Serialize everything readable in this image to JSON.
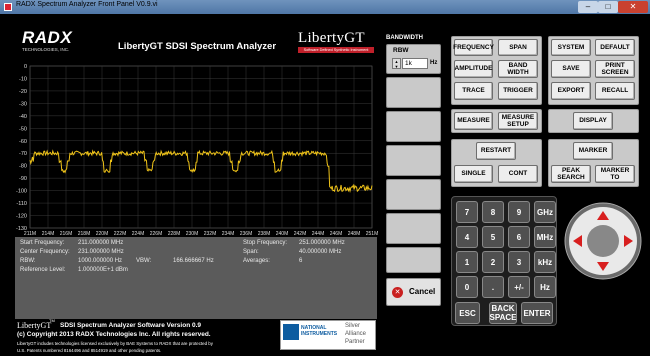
{
  "window": {
    "title": "RADX Spectrum Analyzer Front Panel V0.9.vi",
    "min": "–",
    "max": "□",
    "close": "✕"
  },
  "brand": {
    "radx_logo": "RADX",
    "radx_sub": "TECHNOLOGIES, INC.",
    "product_logo": "LibertyGT",
    "product_tagline": "Software Defined Synthetic Instrument",
    "footer_logo": "LibertyGT",
    "footer_tm": "TM"
  },
  "chart_data": {
    "type": "line",
    "title": "LibertyGT SDSI Spectrum Analyzer",
    "xlabel": "",
    "ylabel": "",
    "x_ticks": [
      "211M",
      "214M",
      "216M",
      "218M",
      "220M",
      "222M",
      "224M",
      "226M",
      "228M",
      "230M",
      "232M",
      "234M",
      "236M",
      "238M",
      "240M",
      "242M",
      "244M",
      "246M",
      "248M",
      "251M"
    ],
    "y_ticks": [
      "0",
      "-10",
      "-20",
      "-30",
      "-40",
      "-50",
      "-60",
      "-70",
      "-80",
      "-90",
      "-100",
      "-110",
      "-120",
      "-130"
    ],
    "xlim": [
      211,
      251
    ],
    "ylim": [
      -130,
      0
    ],
    "grid": true,
    "trace_color": "#f0c419",
    "series": [
      {
        "values": [
          -70,
          -70,
          -70,
          -70,
          -70,
          -70,
          -70,
          -70,
          -70,
          -70,
          -70,
          -70,
          -70,
          -70,
          -70,
          -70,
          -70,
          -70,
          -70,
          -70,
          -70,
          -70,
          -70,
          -70,
          -70,
          -70,
          -70,
          -70,
          -70,
          -70,
          -70,
          -70,
          -70,
          -70,
          -70,
          -70,
          -70,
          -70,
          -70,
          -70,
          -70,
          -70,
          -70,
          -70,
          -70,
          -70,
          -70,
          -70,
          -70,
          -70,
          -70,
          -70,
          -70,
          -70,
          -70,
          -70,
          -70,
          -70,
          -70,
          -70,
          -70,
          -70,
          -70,
          -70,
          -70,
          -70,
          -70,
          -70,
          -70,
          -70,
          -70,
          -70,
          -70,
          -70,
          -70,
          -70,
          -70,
          -70,
          -70,
          -70
        ],
        "x_start": 211,
        "x_end": 251
      }
    ],
    "nulls_at": [
      215,
      220,
      225,
      230,
      235,
      240
    ],
    "null_depth": -84,
    "signal_level": -70,
    "noise_floor": -98,
    "step_at": 246
  },
  "bandwidth": {
    "label": "BANDWIDTH",
    "rbw_label": "RBW",
    "rbw_value": "1k",
    "rbw_unit": "Hz"
  },
  "keys": {
    "frequency": "FREQUENCY",
    "span": "SPAN",
    "amplitude": "AMPLITUDE",
    "bandwidth": "BAND WIDTH",
    "trace": "TRACE",
    "trigger": "TRIGGER",
    "system": "SYSTEM",
    "default": "DEFAULT",
    "save": "SAVE",
    "print": "PRINT SCREEN",
    "export": "EXPORT",
    "recall": "RECALL",
    "measure": "MEASURE",
    "measure_setup": "MEASURE SETUP",
    "display": "DISPLAY",
    "restart": "RESTART",
    "single": "SINGLE",
    "cont": "CONT",
    "marker": "MARKER",
    "peak_search": "PEAK SEARCH",
    "marker_to": "MARKER TO"
  },
  "numpad": [
    "7",
    "8",
    "9",
    "GHz",
    "4",
    "5",
    "6",
    "MHz",
    "1",
    "2",
    "3",
    "kHz",
    "0",
    ".",
    "+/-",
    "Hz"
  ],
  "numpad_bottom": {
    "esc": "ESC",
    "back": "BACK SPACE",
    "enter": "ENTER"
  },
  "cancel": {
    "label": "Cancel",
    "icon": "✕"
  },
  "info": {
    "start_label": "Start Frequency:",
    "start_value": "211.000000 MHz",
    "center_label": "Center Frequency:",
    "center_value": "231.000000 MHz",
    "rbw_label": "RBW:",
    "rbw_value": "1000.000000 Hz",
    "vbw_label": "VBW:",
    "vbw_value": "166.666667 Hz",
    "ref_label": "Reference Level:",
    "ref_value": "1.000000E+1 dBm",
    "stop_label": "Stop Frequency:",
    "stop_value": "251.000000 MHz",
    "span_label": "Span:",
    "span_value": "40.000000 MHz",
    "avg_label": "Averages:",
    "avg_value": "6"
  },
  "footer": {
    "version": "SDSI Spectrum Analyzer Software Version 0.9",
    "copyright": "(c) Copyright 2013 RADX Technologies Inc. All rights reserved.",
    "license": "LibertyGT includes technologies licensed exclusively by BAE Systems to RADX that are protected by",
    "patents": "U.S. Patents numbered 8164496 and 8514919 and other pending patents.",
    "ni_name": "NATIONAL INSTRUMENTS",
    "ni_partner_1": "Silver",
    "ni_partner_2": "Alliance",
    "ni_partner_3": "Partner"
  }
}
